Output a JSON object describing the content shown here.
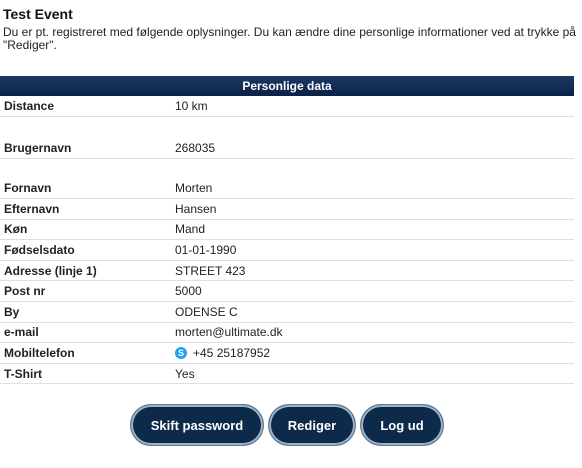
{
  "page": {
    "title": "Test Event",
    "intro": "Du er pt. registreret med følgende oplysninger. Du kan ændre dine personlige informationer ved at trykke på \"Rediger\"."
  },
  "table": {
    "header": "Personlige data",
    "rows": [
      {
        "label": "Distance",
        "value": "10 km"
      },
      {
        "label": "Brugernavn",
        "value": "268035"
      },
      {
        "label": "Fornavn",
        "value": "Morten"
      },
      {
        "label": "Efternavn",
        "value": "Hansen"
      },
      {
        "label": "Køn",
        "value": "Mand"
      },
      {
        "label": "Fødselsdato",
        "value": "01-01-1990"
      },
      {
        "label": "Adresse (linje 1)",
        "value": "STREET 423"
      },
      {
        "label": "Post nr",
        "value": "5000"
      },
      {
        "label": "By",
        "value": "ODENSE C"
      },
      {
        "label": "e-mail",
        "value": "morten@ultimate.dk"
      },
      {
        "label": "Mobiltelefon",
        "value": "+45 25187952",
        "icon": "skype-icon",
        "color": "#1a8fd6"
      },
      {
        "label": "T-Shirt",
        "value": "Yes"
      }
    ]
  },
  "buttons": {
    "change_password": "Skift password",
    "edit": "Rediger",
    "logout": "Log ud"
  }
}
